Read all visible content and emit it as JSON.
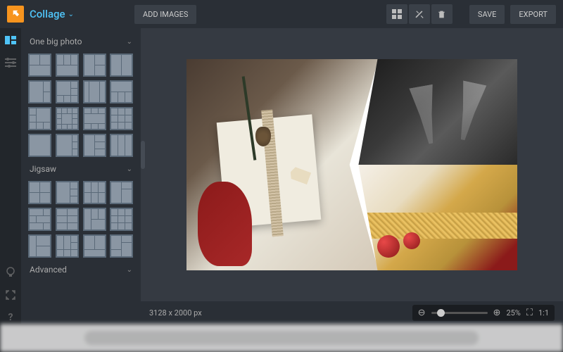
{
  "header": {
    "app_title": "Collage",
    "add_images_label": "ADD IMAGES",
    "save_label": "SAVE",
    "export_label": "EXPORT"
  },
  "sidebar": {
    "sections": [
      {
        "label": "One big photo"
      },
      {
        "label": "Jigsaw"
      },
      {
        "label": "Advanced"
      }
    ]
  },
  "status": {
    "dimensions": "3128 x 2000 px",
    "zoom_percent": "25%",
    "ratio_label": "1:1"
  },
  "colors": {
    "accent": "#4fc3f7",
    "brand": "#f7941e",
    "panel": "#2a2f36"
  },
  "icons": {
    "rail": [
      "templates-icon",
      "sliders-icon",
      "tip-icon",
      "fullscreen-icon",
      "help-icon"
    ],
    "toolbar": [
      "grid-icon",
      "shuffle-icon",
      "trash-icon"
    ]
  }
}
